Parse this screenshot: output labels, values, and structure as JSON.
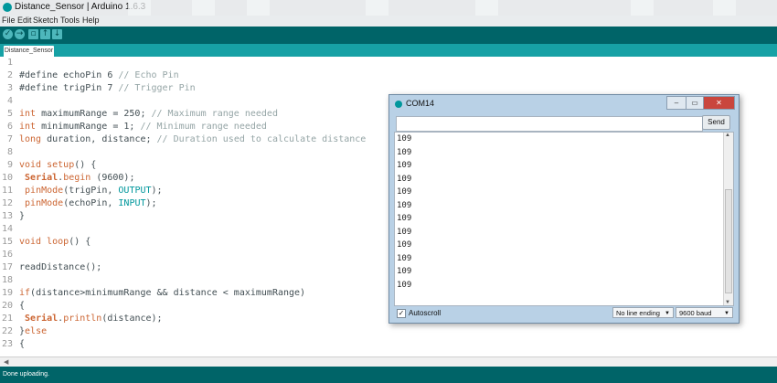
{
  "window": {
    "title": "Distance_Sensor | Arduino 1.6.3"
  },
  "menu": [
    "File",
    "Edit",
    "Sketch",
    "Tools",
    "Help"
  ],
  "toolbar": {
    "icons": [
      "verify-icon",
      "upload-icon",
      "new-icon",
      "open-icon",
      "save-icon"
    ]
  },
  "tab": {
    "label": "Distance_Sensor"
  },
  "editor": {
    "line_numbers": [
      "1",
      "2",
      "3",
      "4",
      "5",
      "6",
      "7",
      "8",
      "9",
      "10",
      "11",
      "12",
      "13",
      "14",
      "15",
      "16",
      "17",
      "18",
      "19",
      "20",
      "21",
      "22",
      "23"
    ]
  },
  "status": {
    "message": "Done uploading."
  },
  "serial_monitor": {
    "title": "COM14",
    "input_value": "",
    "send_label": "Send",
    "output_lines": [
      "109",
      "109",
      "109",
      "109",
      "109",
      "109",
      "109",
      "109",
      "109",
      "109",
      "109",
      "109"
    ],
    "autoscroll_label": "Autoscroll",
    "autoscroll_checked": true,
    "line_ending": "No line ending",
    "baud": "9600 baud",
    "window_buttons": [
      "minimize",
      "maximize",
      "close"
    ]
  },
  "colors": {
    "toolbar": "#006468",
    "tabs": "#17a1a5",
    "keyword": "#cc6633",
    "constant": "#00979c",
    "comment": "#95a5a6"
  }
}
